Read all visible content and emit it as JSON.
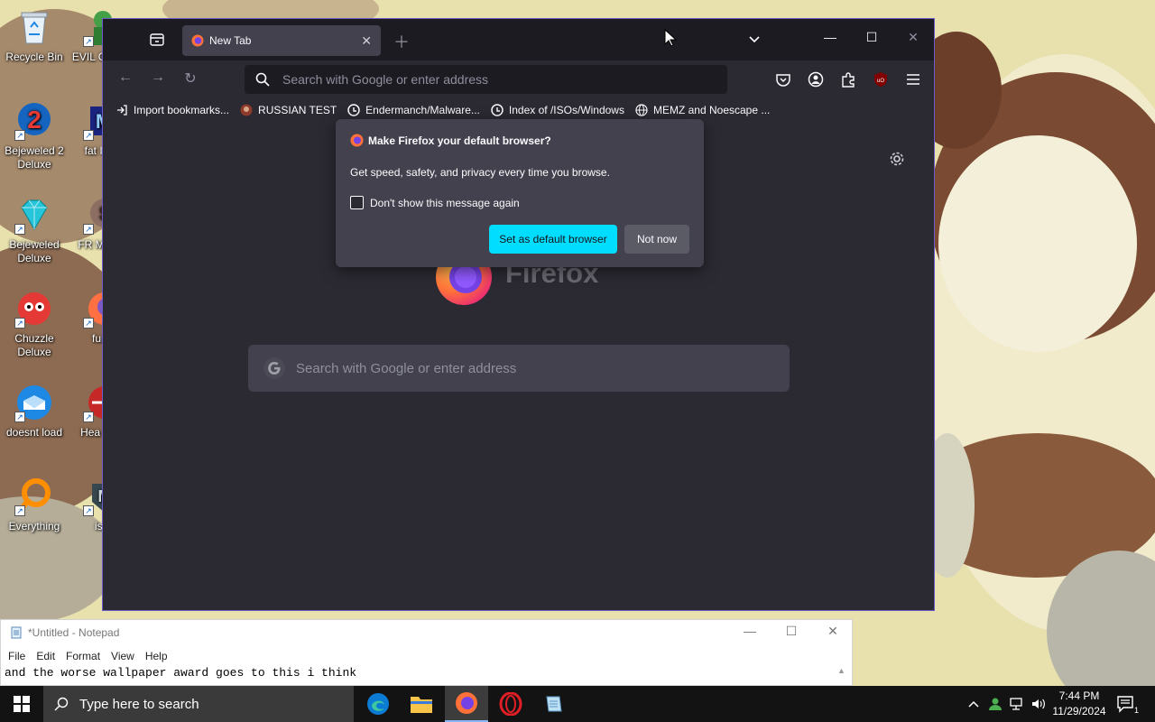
{
  "desktop": {
    "icons_col1": [
      {
        "label": "Recycle Bin",
        "icon": "recycle-bin-icon"
      },
      {
        "label": "Bejeweled 2 Deluxe",
        "icon": "bejeweled2-icon"
      },
      {
        "label": "Bejeweled Deluxe",
        "icon": "bejeweled-icon"
      },
      {
        "label": "Chuzzle Deluxe",
        "icon": "chuzzle-icon"
      },
      {
        "label": "doesnt load",
        "icon": "thunderbird-icon"
      },
      {
        "label": "Everything",
        "icon": "everything-search-icon"
      }
    ],
    "icons_col2": [
      {
        "label": "EVIL G MEN",
        "icon": "evil-icon"
      },
      {
        "label": "fat I dar",
        "icon": "fat-icon"
      },
      {
        "label": "FR MONE",
        "icon": "money-icon"
      },
      {
        "label": "furry",
        "icon": "firefox-furry-icon"
      },
      {
        "label": "Hea Wea",
        "icon": "heat-icon"
      },
      {
        "label": "is v",
        "icon": "isv-icon"
      }
    ]
  },
  "firefox": {
    "tab_title": "New Tab",
    "url_placeholder": "Search with Google or enter address",
    "bookmarks": [
      {
        "label": "Import bookmarks...",
        "icon": "import-icon"
      },
      {
        "label": "RUSSIAN TEST",
        "icon": "russian-test-icon"
      },
      {
        "label": "Endermanch/Malware...",
        "icon": "github-icon"
      },
      {
        "label": "Index of /ISOs/Windows",
        "icon": "globe-icon"
      },
      {
        "label": "MEMZ and Noescape ...",
        "icon": "globe-icon"
      }
    ],
    "wordmark": "Firefox",
    "search_placeholder": "Search with Google or enter address",
    "popup": {
      "title": "Make Firefox your default browser?",
      "message": "Get speed, safety, and privacy every time you browse.",
      "checkbox_label": "Don't show this message again",
      "checkbox_checked": false,
      "primary_button": "Set as default browser",
      "secondary_button": "Not now"
    }
  },
  "notepad": {
    "title": "*Untitled - Notepad",
    "menu": [
      "File",
      "Edit",
      "Format",
      "View",
      "Help"
    ],
    "content": "and the worse wallpaper award goes to this i think"
  },
  "taskbar": {
    "search_placeholder": "Type here to search",
    "apps": [
      "edge-icon",
      "file-explorer-icon",
      "firefox-icon",
      "opera-icon",
      "notepad-icon"
    ],
    "active_app": "firefox-icon",
    "time": "7:44 PM",
    "date": "11/29/2024",
    "notification_count": "1"
  },
  "colors": {
    "firefox_accent": "#00ddff",
    "firefox_bg": "#2b2a33",
    "taskbar_bg": "#131313"
  }
}
